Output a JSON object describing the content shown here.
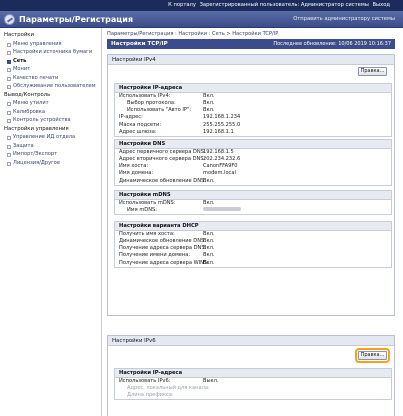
{
  "topbar": {
    "link1": "К порталу",
    "user": "Зарегистрированный пользователь: Администратор системы",
    "logout": "Выход"
  },
  "header": {
    "title": "Параметры/Регистрация",
    "mail_link": "Отправить администратору системы"
  },
  "sidebar": {
    "groups": [
      {
        "title": "Настройки",
        "items": [
          {
            "label": "Меню управления",
            "active": false
          },
          {
            "label": "Настройки источника бумаги",
            "active": false
          },
          {
            "label": "Сеть",
            "active": true
          },
          {
            "label": "Монит",
            "active": false
          },
          {
            "label": "Качество печати",
            "active": false
          },
          {
            "label": "Обслуживание пользователем",
            "active": false
          }
        ]
      },
      {
        "title": "Вывод/Контроль",
        "items": [
          {
            "label": "Меню утилит",
            "active": false
          },
          {
            "label": "Калибровка",
            "active": false
          },
          {
            "label": "Контроль устройства",
            "active": false
          }
        ]
      },
      {
        "title": "Настройки управления",
        "items": [
          {
            "label": "Управление ИД отдела",
            "active": false
          },
          {
            "label": "Защита",
            "active": false
          },
          {
            "label": "Импорт/Экспорт",
            "active": false
          },
          {
            "label": "Лицензия/Другое",
            "active": false
          }
        ]
      }
    ]
  },
  "main": {
    "breadcrumb": "Параметры/Регистрация : Настройки : Сеть > Настройки TCP/IP",
    "page_title": "Настройки TCP/IP",
    "last_updated": "Последнее обновление: 10/06 2019 10:16:37",
    "ipv4": {
      "title": "Настройки IPv4",
      "edit": "Правка...",
      "ip_section": {
        "title": "Настройки IP-адреса",
        "rows": [
          {
            "label": "Использовать IPv4:",
            "value": "Вкл.",
            "indent": false
          },
          {
            "label": "Выбор протокола:",
            "value": "Вкл.",
            "indent": true
          },
          {
            "label": "Использовать \"Авто IP\":",
            "value": "Вкл.",
            "indent": true
          },
          {
            "label": "IP-адрес:",
            "value": "192.168.1.234",
            "indent": false
          },
          {
            "label": "Маска подсети:",
            "value": "255.255.255.0",
            "indent": false
          },
          {
            "label": "Адрес шлюза:",
            "value": "192.168.1.1",
            "indent": false
          }
        ]
      },
      "dns_section": {
        "title": "Настройки DNS",
        "rows": [
          {
            "label": "Адрес первичного сервера DNS:",
            "value": "192.168.1.5",
            "indent": false
          },
          {
            "label": "Адрес вторичного сервера DNS:",
            "value": "202.234.232.6",
            "indent": false
          },
          {
            "label": "Имя хоста:",
            "value": "CanonFFA9F0",
            "indent": false
          },
          {
            "label": "Имя домена:",
            "value": "modem.local",
            "indent": false
          },
          {
            "label": "Динамическое обновление DNS:",
            "value": "Вкл.",
            "indent": false
          }
        ]
      },
      "mdns_section": {
        "title": "Настройки mDNS",
        "rows": [
          {
            "label": "Использовать mDNS:",
            "value": "Вкл.",
            "indent": false
          },
          {
            "label": "Имя mDNS:",
            "value": "",
            "indent": true
          }
        ]
      },
      "dhcp_section": {
        "title": "Настройки варианта DHCP",
        "rows": [
          {
            "label": "Получить имя хоста:",
            "value": "Вкл.",
            "indent": false
          },
          {
            "label": "Динамическое обновление DNS:",
            "value": "Вкл.",
            "indent": false
          },
          {
            "label": "Получение адреса сервера DNS:",
            "value": "Вкл.",
            "indent": false
          },
          {
            "label": "Получение имени домена:",
            "value": "Вкл.",
            "indent": false
          },
          {
            "label": "Получение адреса сервера WINS:",
            "value": "Вкл.",
            "indent": false
          }
        ]
      }
    },
    "ipv6": {
      "title": "Настройки IPv6",
      "edit": "Правка...",
      "ip_section": {
        "title": "Настройки IP-адреса",
        "rows": [
          {
            "label": "Использовать IPv6:",
            "value": "Выкл.",
            "indent": false
          },
          {
            "label": "Адрес, локальный для канала:",
            "value": "",
            "indent": true
          },
          {
            "label": "Длина префикса:",
            "value": "",
            "indent": true
          }
        ]
      }
    }
  }
}
